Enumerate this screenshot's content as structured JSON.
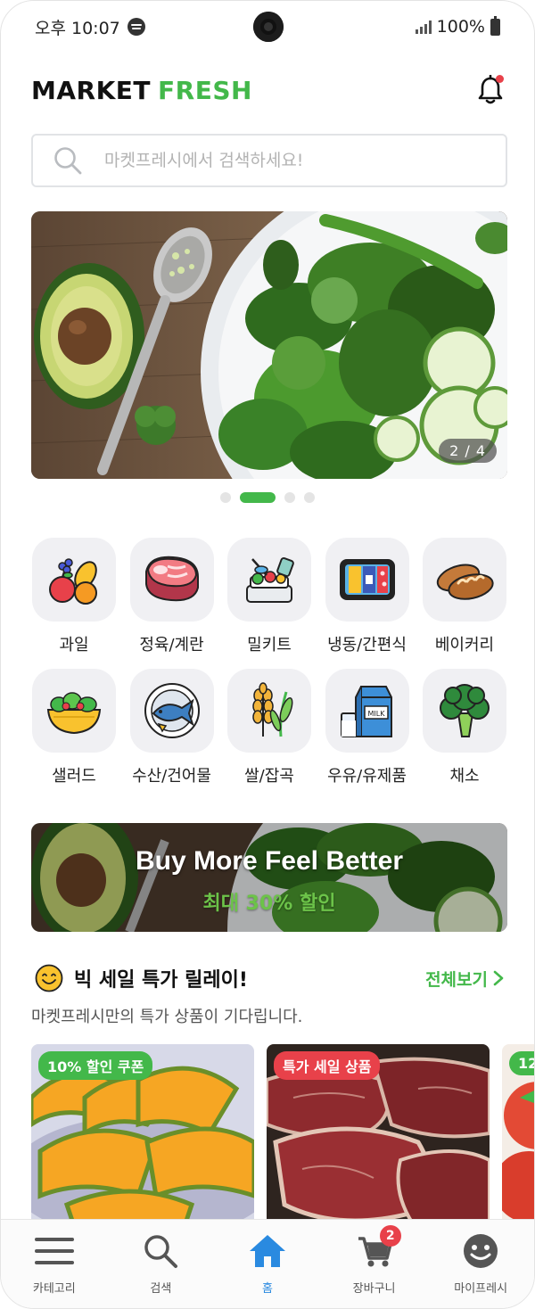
{
  "status_bar": {
    "time": "오후 10:07",
    "battery": "100%"
  },
  "brand": {
    "word1": "MARKET",
    "word2": "FRESH"
  },
  "header": {
    "notification_icon": "bell-icon",
    "has_notification": true
  },
  "search": {
    "placeholder": "마켓프레시에서 검색하세요!",
    "value": ""
  },
  "banner": {
    "counter": "2 / 4",
    "current": 2,
    "total": 4
  },
  "categories": [
    {
      "label": "과일",
      "icon": "fruit-icon"
    },
    {
      "label": "정육/계란",
      "icon": "meat-icon"
    },
    {
      "label": "밀키트",
      "icon": "meal-kit-icon"
    },
    {
      "label": "냉동/간편식",
      "icon": "frozen-food-icon"
    },
    {
      "label": "베이커리",
      "icon": "bread-icon"
    },
    {
      "label": "샐러드",
      "icon": "salad-icon"
    },
    {
      "label": "수산/건어물",
      "icon": "fish-icon"
    },
    {
      "label": "쌀/잡곡",
      "icon": "grain-icon"
    },
    {
      "label": "우유/유제품",
      "icon": "milk-icon"
    },
    {
      "label": "채소",
      "icon": "broccoli-icon"
    }
  ],
  "promo": {
    "title": "Buy More Feel Better",
    "subtitle": "최대 30% 할인"
  },
  "section": {
    "title": "빅 세일 특가 릴레이!",
    "subtitle": "마켓프레시만의 특가 상품이 기다립니다.",
    "view_all": "전체보기"
  },
  "products": [
    {
      "tag": "10% 할인 쿠폰",
      "tag_color": "#43b84a"
    },
    {
      "tag": "특가 세일 상품",
      "tag_color": "#e8414a"
    },
    {
      "tag": "12",
      "tag_color": "#43b84a"
    }
  ],
  "bottom_nav": [
    {
      "label": "카테고리",
      "icon": "menu-icon"
    },
    {
      "label": "검색",
      "icon": "search-icon"
    },
    {
      "label": "홈",
      "icon": "home-icon",
      "active": true
    },
    {
      "label": "장바구니",
      "icon": "cart-icon",
      "badge": "2"
    },
    {
      "label": "마이프레시",
      "icon": "profile-icon"
    }
  ],
  "colors": {
    "accent": "#43b84a",
    "alert": "#e8414a",
    "nav_active": "#2a8ae0"
  }
}
